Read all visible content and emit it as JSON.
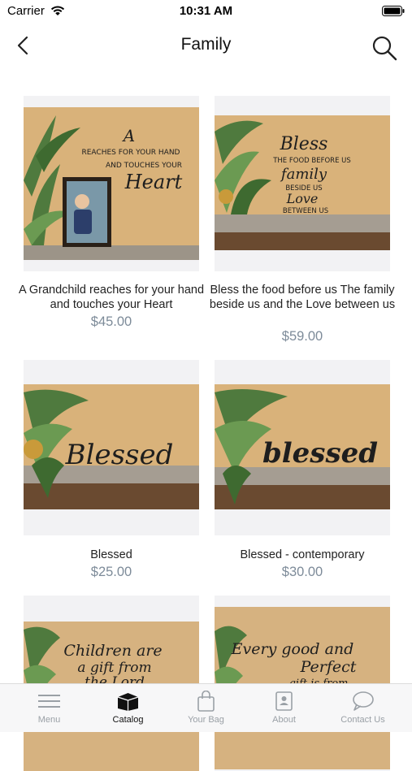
{
  "status": {
    "carrier": "Carrier",
    "time": "10:31 AM"
  },
  "nav": {
    "title": "Family"
  },
  "products": [
    {
      "title": "A Grandchild reaches for your hand and touches your Heart",
      "price": "$45.00",
      "sign_text": "A GRANDCHILD REACHES FOR YOUR HAND AND TOUCHES YOUR Heart"
    },
    {
      "title": "Bless the food before us The family beside us and the Love between us",
      "price": "$59.00",
      "sign_text": "Bless THE FOOD BEFORE US THE family BESIDE US AND Love BETWEEN US"
    },
    {
      "title": "Blessed",
      "price": "$25.00",
      "sign_text": "Blessed"
    },
    {
      "title": "Blessed - contemporary",
      "price": "$30.00",
      "sign_text": "blessed"
    },
    {
      "title": "",
      "price": "",
      "sign_text": "Children are a gift from the Lord"
    },
    {
      "title": "",
      "price": "",
      "sign_text": "Every good and Perfect gift is from"
    }
  ],
  "tabs": [
    {
      "label": "Menu",
      "icon": "menu-icon"
    },
    {
      "label": "Catalog",
      "icon": "catalog-box-icon"
    },
    {
      "label": "Your Bag",
      "icon": "shopping-bag-icon"
    },
    {
      "label": "About",
      "icon": "about-contact-card-icon"
    },
    {
      "label": "Contact Us",
      "icon": "chat-bubble-icon"
    }
  ],
  "active_tab": "Catalog",
  "colors": {
    "price": "#7d8b99",
    "wall": "#d9b27a",
    "tab_inactive": "#9aa0a6"
  }
}
